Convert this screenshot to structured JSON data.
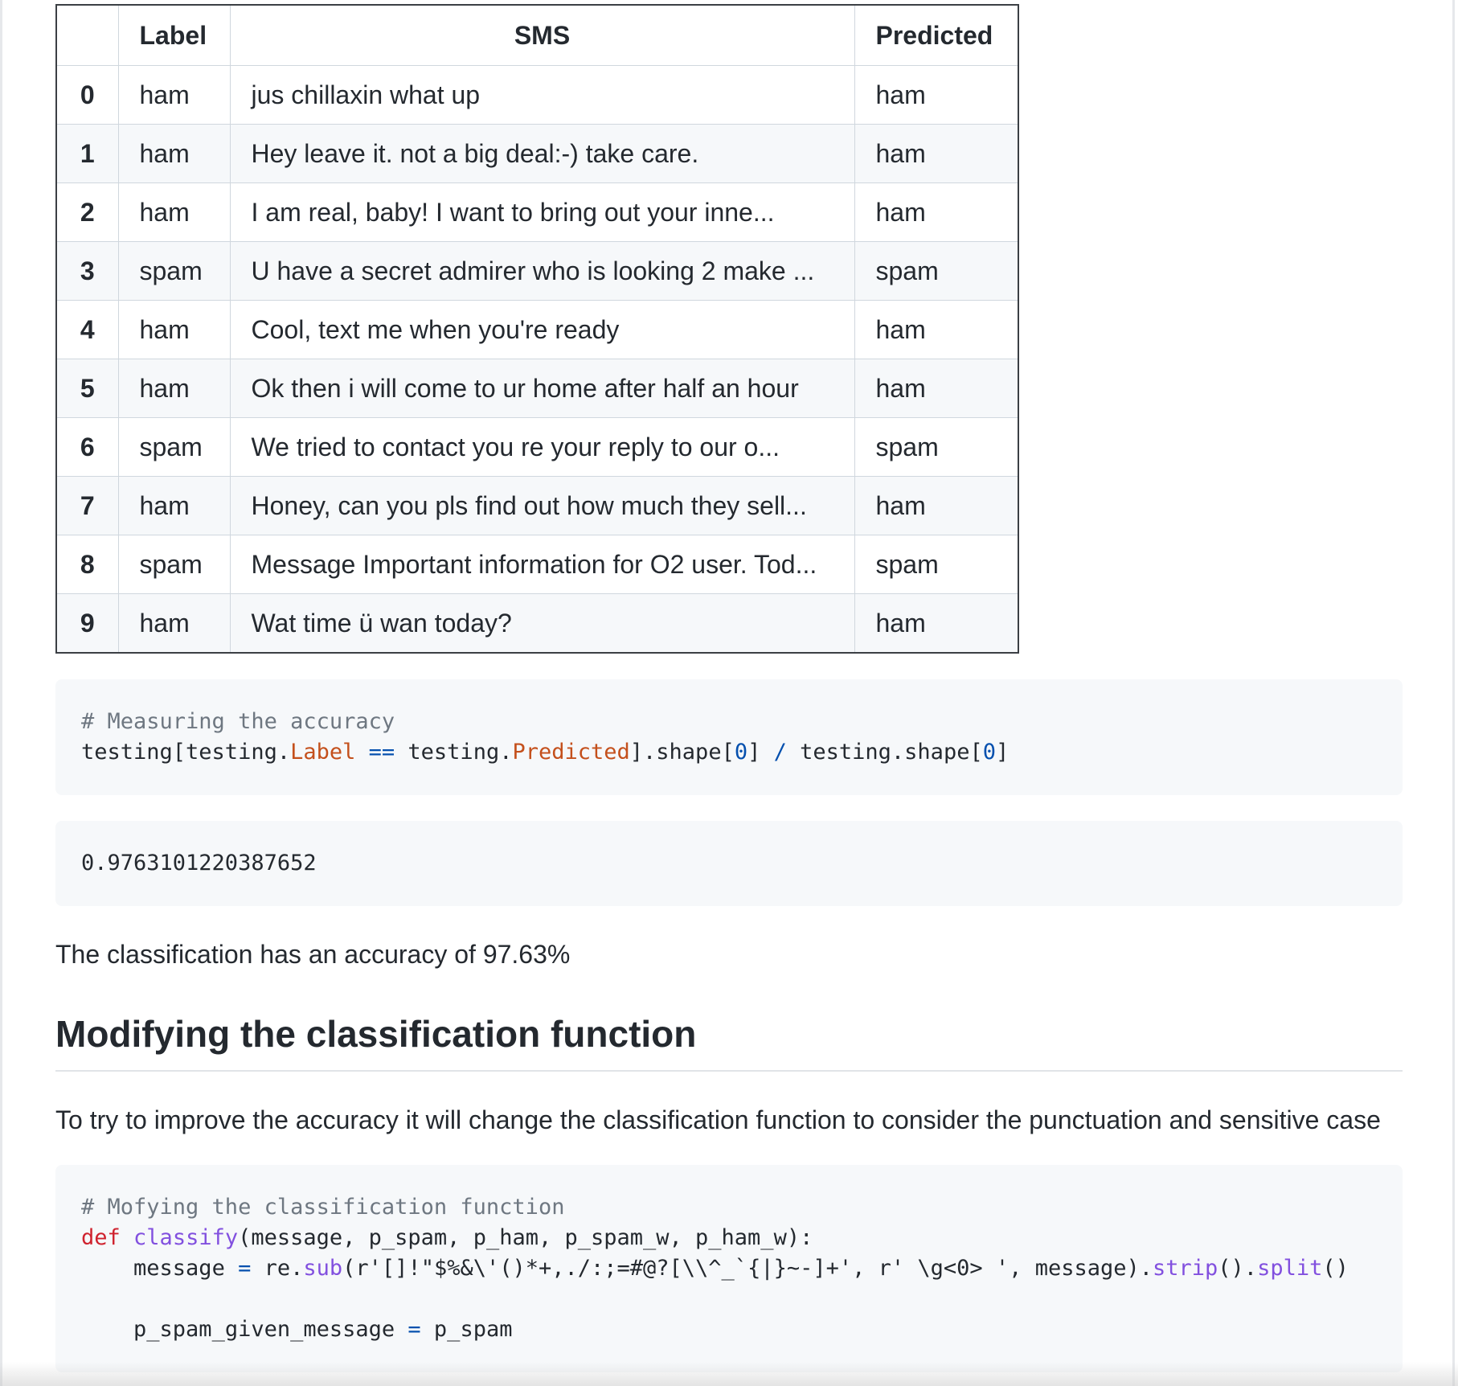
{
  "table": {
    "headers": [
      "",
      "Label",
      "SMS",
      "Predicted"
    ],
    "rows": [
      {
        "idx": "0",
        "label": "ham",
        "sms": "jus chillaxin what up",
        "predicted": "ham"
      },
      {
        "idx": "1",
        "label": "ham",
        "sms": "Hey leave it. not a big deal:-) take care.",
        "predicted": "ham"
      },
      {
        "idx": "2",
        "label": "ham",
        "sms": "I am real, baby! I want to bring out your inne...",
        "predicted": "ham"
      },
      {
        "idx": "3",
        "label": "spam",
        "sms": "U have a secret admirer who is looking 2 make ...",
        "predicted": "spam"
      },
      {
        "idx": "4",
        "label": "ham",
        "sms": "Cool, text me when you're ready",
        "predicted": "ham"
      },
      {
        "idx": "5",
        "label": "ham",
        "sms": "Ok then i will come to ur home after half an hour",
        "predicted": "ham"
      },
      {
        "idx": "6",
        "label": "spam",
        "sms": "We tried to contact you re your reply to our o...",
        "predicted": "spam"
      },
      {
        "idx": "7",
        "label": "ham",
        "sms": "Honey, can you pls find out how much they sell...",
        "predicted": "ham"
      },
      {
        "idx": "8",
        "label": "spam",
        "sms": "Message Important information for O2 user. Tod...",
        "predicted": "spam"
      },
      {
        "idx": "9",
        "label": "ham",
        "sms": "Wat time ü wan today?",
        "predicted": "ham"
      }
    ]
  },
  "code1": {
    "comment": "# Measuring the accuracy",
    "tokens": [
      "testing[testing.",
      "Label",
      " ",
      "==",
      " testing.",
      "Predicted",
      "].shape[",
      "0",
      "] ",
      "/",
      " testing.shape[",
      "0",
      "]"
    ]
  },
  "output1": "0.9763101220387652",
  "accuracy_text": "The classification has an accuracy of 97.63%",
  "heading": "Modifying the classification function",
  "description": "To try to improve the accuracy it will change the classification function to consider the punctuation and sensitive case",
  "code2": {
    "comment": "# Mofying the classification function",
    "line1": {
      "kw": "def",
      "fn": "classify",
      "rest": "(message, p_spam, p_ham, p_spam_w, p_ham_w):"
    },
    "line2": {
      "indent": "    ",
      "a": "message ",
      "op": "=",
      "b": " re.",
      "fn": "sub",
      "c": "(r'[]!\"$%&\\'()*+,./:;=#@?[\\\\^_`{|}~-]+', r' \\g<0> ', message).",
      "fn2": "strip",
      "d": "().",
      "fn3": "split",
      "e": "()"
    },
    "line4": {
      "indent": "    ",
      "a": "p_spam_given_message ",
      "op": "=",
      "b": " p_spam"
    }
  }
}
